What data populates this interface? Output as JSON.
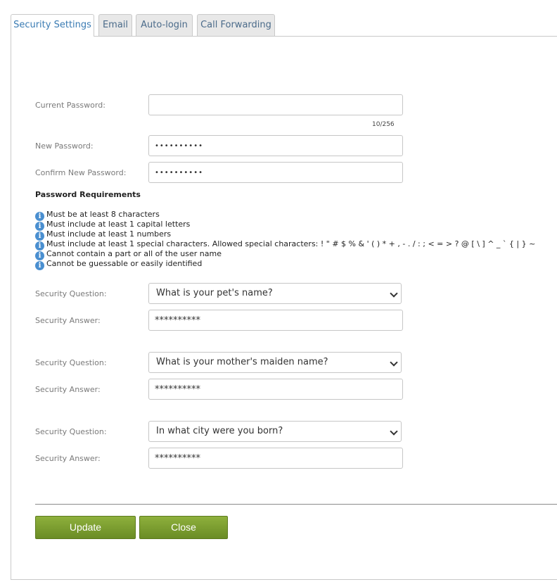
{
  "tabs": [
    {
      "label": "Security Settings",
      "active": true
    },
    {
      "label": "Email"
    },
    {
      "label": "Auto-login"
    },
    {
      "label": "Call Forwarding"
    }
  ],
  "password": {
    "current_label": "Current Password:",
    "current_value": "",
    "counter": "10/256",
    "new_label": "New Password:",
    "new_value": "••••••••••",
    "confirm_label": "Confirm New Password:",
    "confirm_value": "••••••••••"
  },
  "requirements": {
    "title": "Password Requirements",
    "items": [
      "Must be at least 8 characters",
      "Must include at least 1 capital letters",
      "Must include at least 1 numbers",
      "Must include at least 1 special characters. Allowed special characters: ! \" # $ % & ' ( ) * + , - . / : ; < = > ? @ [ \\ ] ^ _ ` { | } ~",
      "Cannot contain a part or all of the user name",
      "Cannot be guessable or easily identified"
    ]
  },
  "security": [
    {
      "question_label": "Security Question:",
      "question": "What is your pet's name?",
      "answer_label": "Security Answer:",
      "answer": "**********"
    },
    {
      "question_label": "Security Question:",
      "question": "What is your mother's maiden name?",
      "answer_label": "Security Answer:",
      "answer": "**********"
    },
    {
      "question_label": "Security Question:",
      "question": "In what city were you born?",
      "answer_label": "Security Answer:",
      "answer": "**********"
    }
  ],
  "buttons": {
    "update": "Update",
    "close": "Close"
  },
  "colors": {
    "button_green": "#7a9c2e",
    "tab_text": "#3a7bb3",
    "info_icon": "#4a8fd0"
  }
}
